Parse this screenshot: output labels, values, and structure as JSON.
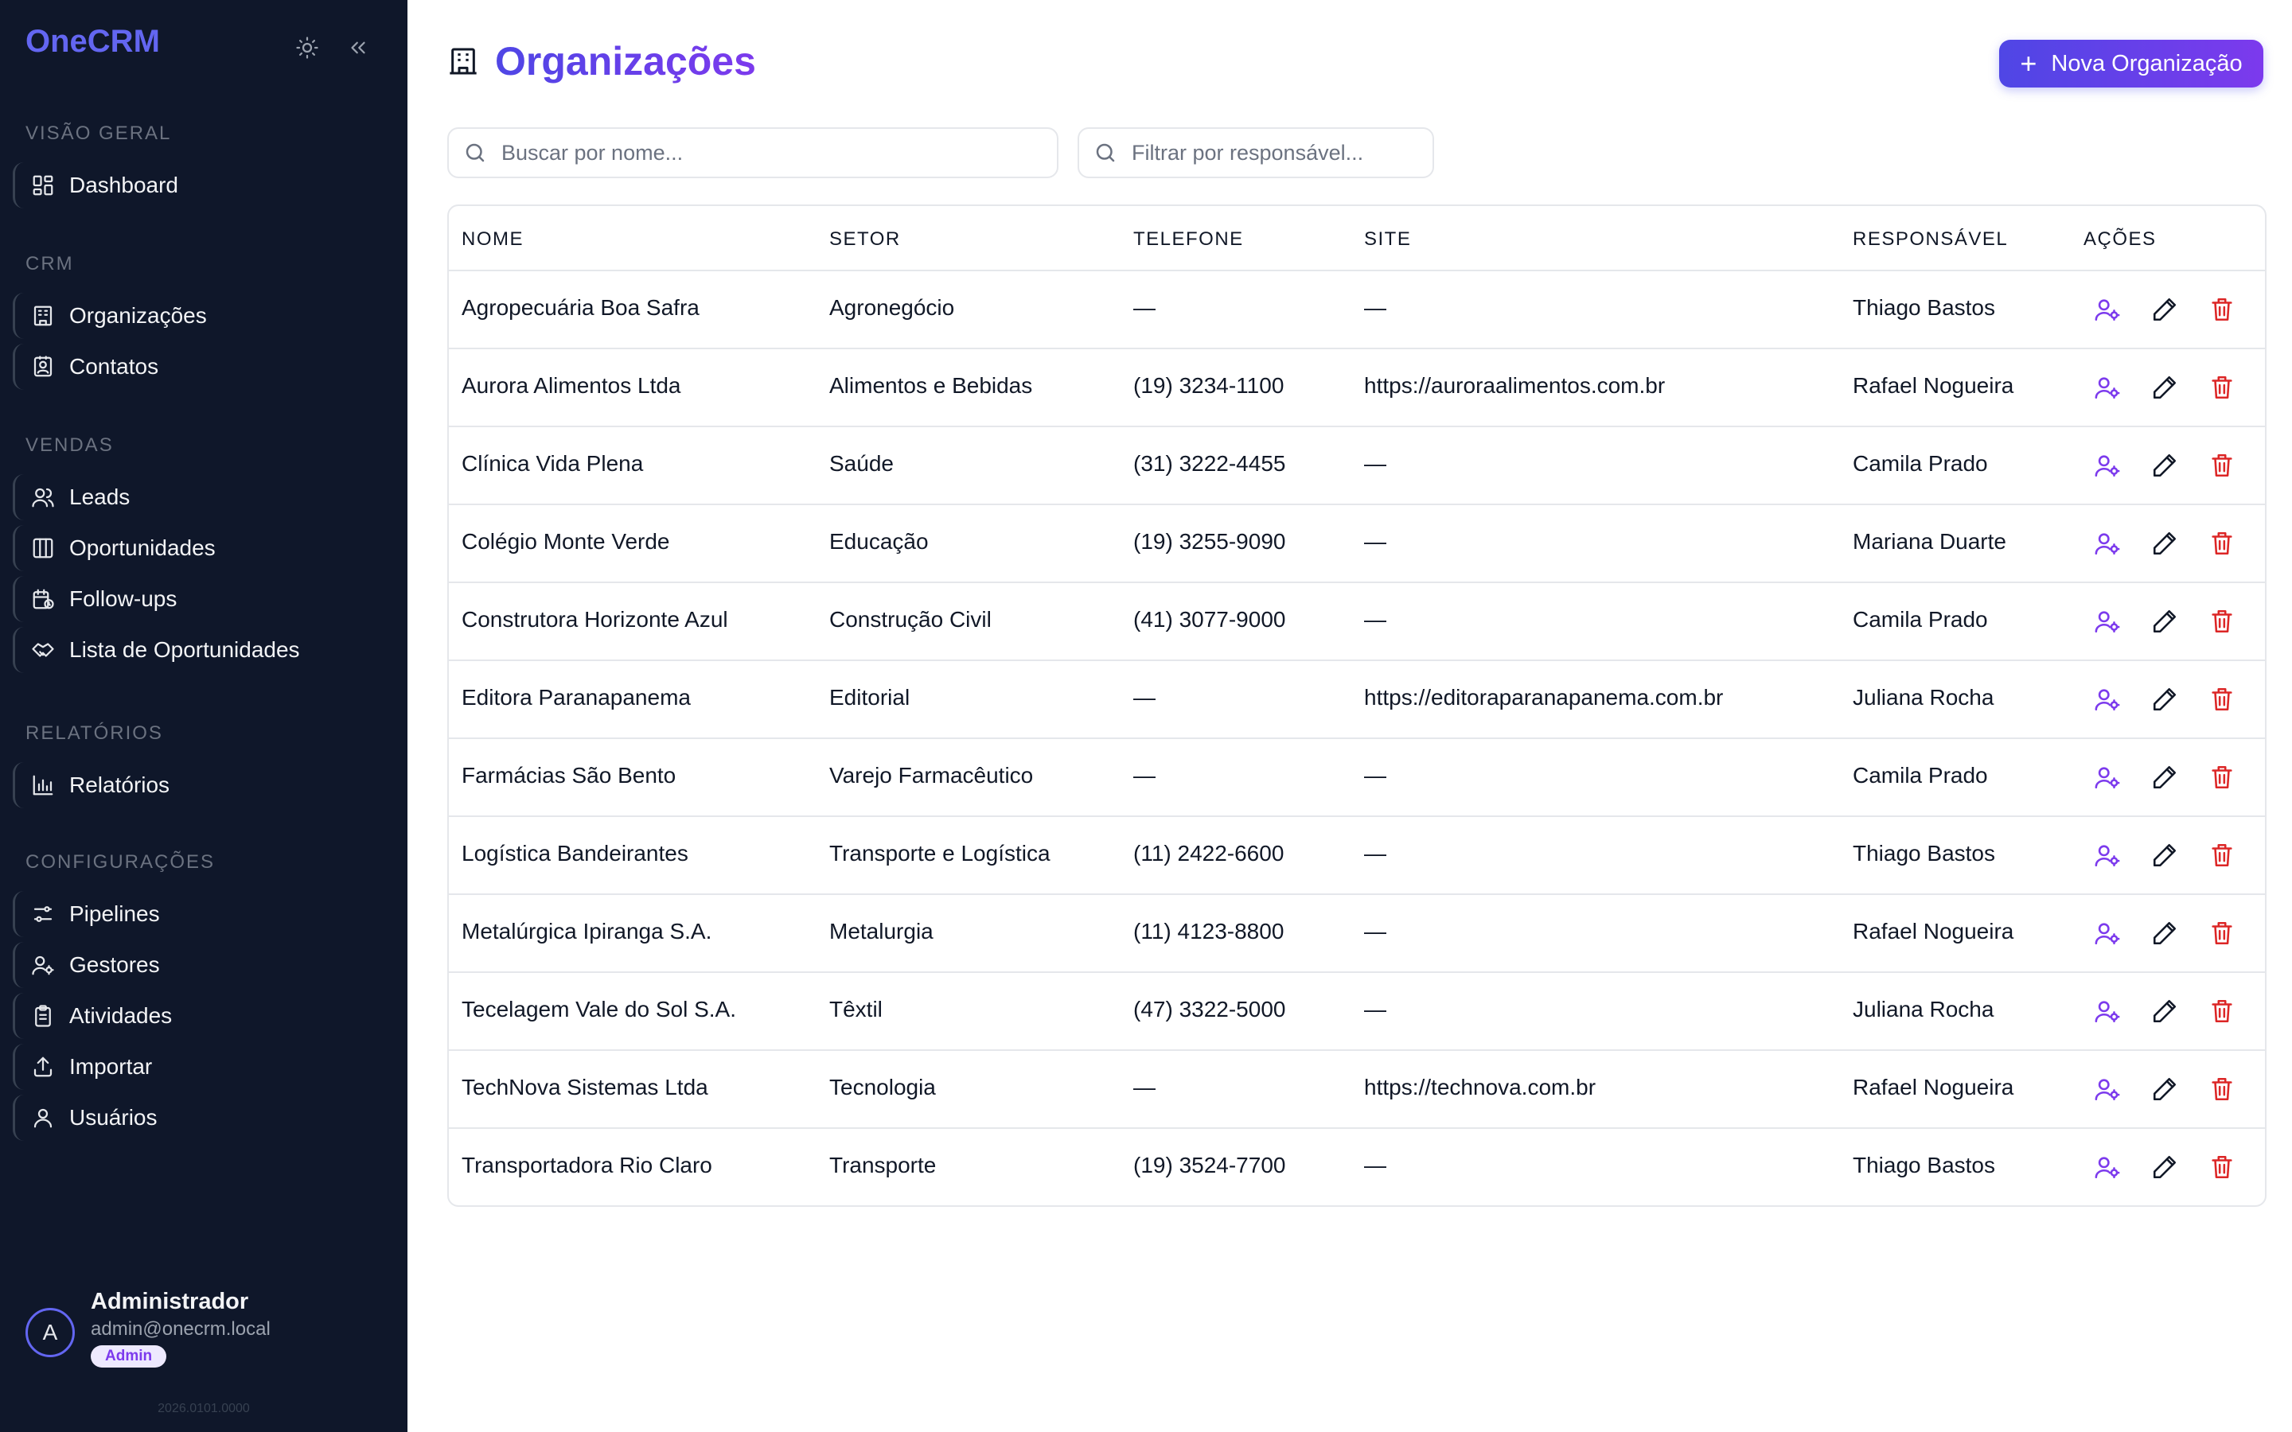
{
  "sidebar": {
    "brand": "OneCRM",
    "sections": [
      {
        "title": "VISÃO GERAL",
        "items": [
          {
            "label": "Dashboard",
            "icon": "dashboard-icon"
          }
        ]
      },
      {
        "title": "CRM",
        "items": [
          {
            "label": "Organizações",
            "icon": "building-icon"
          },
          {
            "label": "Contatos",
            "icon": "contact-icon"
          }
        ]
      },
      {
        "title": "VENDAS",
        "items": [
          {
            "label": "Leads",
            "icon": "users-icon"
          },
          {
            "label": "Oportunidades",
            "icon": "columns-icon"
          },
          {
            "label": "Follow-ups",
            "icon": "calendar-clock-icon"
          },
          {
            "label": "Lista de Oportunidades",
            "icon": "handshake-icon"
          }
        ]
      },
      {
        "title": "RELATÓRIOS",
        "items": [
          {
            "label": "Relatórios",
            "icon": "bar-chart-icon"
          }
        ]
      },
      {
        "title": "CONFIGURAÇÕES",
        "items": [
          {
            "label": "Pipelines",
            "icon": "sliders-icon"
          },
          {
            "label": "Gestores",
            "icon": "user-cog-icon"
          },
          {
            "label": "Atividades",
            "icon": "clipboard-icon"
          },
          {
            "label": "Importar",
            "icon": "upload-icon"
          },
          {
            "label": "Usuários",
            "icon": "user-icon"
          }
        ]
      }
    ],
    "user": {
      "initial": "A",
      "name": "Administrador",
      "email": "admin@onecrm.local",
      "role": "Admin"
    },
    "version": "2026.0101.0000"
  },
  "page": {
    "title": "Organizações",
    "new_button": "Nova Organização",
    "search_placeholder": "Buscar por nome...",
    "owner_filter_placeholder": "Filtrar por responsável..."
  },
  "table": {
    "columns": [
      "NOME",
      "SETOR",
      "TELEFONE",
      "SITE",
      "RESPONSÁVEL",
      "AÇÕES"
    ],
    "rows": [
      [
        "Agropecuária Boa Safra",
        "Agronegócio",
        "—",
        "—",
        "Thiago Bastos"
      ],
      [
        "Aurora Alimentos Ltda",
        "Alimentos e Bebidas",
        "(19) 3234-1100",
        "https://auroraalimentos.com.br",
        "Rafael Nogueira"
      ],
      [
        "Clínica Vida Plena",
        "Saúde",
        "(31) 3222-4455",
        "—",
        "Camila Prado"
      ],
      [
        "Colégio Monte Verde",
        "Educação",
        "(19) 3255-9090",
        "—",
        "Mariana Duarte"
      ],
      [
        "Construtora Horizonte Azul",
        "Construção Civil",
        "(41) 3077-9000",
        "—",
        "Camila Prado"
      ],
      [
        "Editora Paranapanema",
        "Editorial",
        "—",
        "https://editoraparanapanema.com.br",
        "Juliana Rocha"
      ],
      [
        "Farmácias São Bento",
        "Varejo Farmacêutico",
        "—",
        "—",
        "Camila Prado"
      ],
      [
        "Logística Bandeirantes",
        "Transporte e Logística",
        "(11) 2422-6600",
        "—",
        "Thiago Bastos"
      ],
      [
        "Metalúrgica Ipiranga S.A.",
        "Metalurgia",
        "(11) 4123-8800",
        "—",
        "Rafael Nogueira"
      ],
      [
        "Tecelagem Vale do Sol S.A.",
        "Têxtil",
        "(47) 3322-5000",
        "—",
        "Juliana Rocha"
      ],
      [
        "TechNova Sistemas Ltda",
        "Tecnologia",
        "—",
        "https://technova.com.br",
        "Rafael Nogueira"
      ],
      [
        "Transportadora Rio Claro",
        "Transporte",
        "(19) 3524-7700",
        "—",
        "Thiago Bastos"
      ]
    ]
  },
  "colors": {
    "accent": "#6366f1",
    "accent2": "#7c3aed",
    "sidebar_bg": "#0f172a",
    "danger": "#dc2626"
  }
}
